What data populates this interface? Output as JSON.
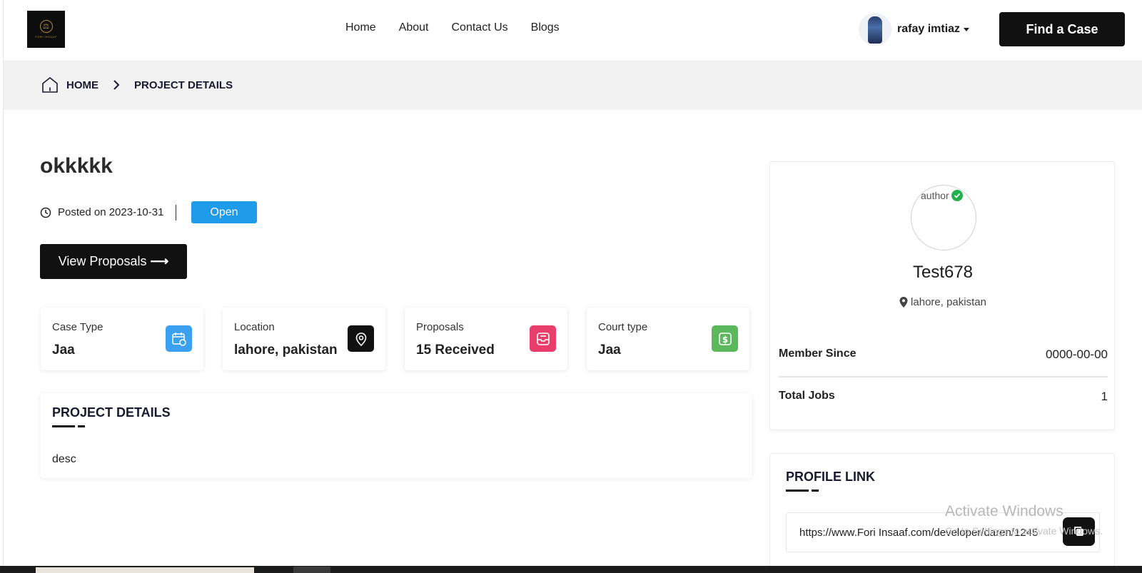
{
  "header": {
    "logo_text": "FORI INSAAF",
    "nav": [
      "Home",
      "About",
      "Contact Us",
      "Blogs"
    ],
    "user_name": "rafay imtiaz",
    "find_case_label": "Find a Case"
  },
  "breadcrumb": {
    "home": "HOME",
    "current": "PROJECT DETAILS"
  },
  "project": {
    "title": "okkkkk",
    "posted": "Posted on 2023-10-31",
    "status": "Open",
    "view_proposals": "View Proposals",
    "cards": [
      {
        "label": "Case Type",
        "value": "Jaa",
        "icon": "calendar-icon",
        "color": "#3aa0ef"
      },
      {
        "label": "Location",
        "value": "lahore, pakistan",
        "icon": "map-pin-icon",
        "color": "#111111"
      },
      {
        "label": "Proposals",
        "value": "15 Received",
        "icon": "inbox-icon",
        "color": "#e93d6b"
      },
      {
        "label": "Court type",
        "value": "Jaa",
        "icon": "dollar-icon",
        "color": "#5cb85c"
      }
    ],
    "details_heading": "PROJECT DETAILS",
    "description": "desc"
  },
  "profile": {
    "avatar_alt": "author",
    "name": "Test678",
    "location": "lahore, pakistan",
    "member_since_label": "Member Since",
    "member_since_value": "0000-00-00",
    "total_jobs_label": "Total Jobs",
    "total_jobs_value": "1"
  },
  "profile_link": {
    "heading": "PROFILE LINK",
    "url": "https://www.Fori Insaaf.com/developer/daren/1245"
  },
  "os": {
    "watermark_title": "Activate Windows",
    "watermark_sub": "Go to Settings to activate Windows."
  }
}
